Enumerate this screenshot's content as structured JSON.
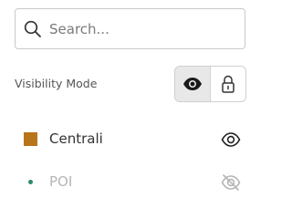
{
  "search": {
    "placeholder": "Search...",
    "value": "",
    "icon": "search-icon"
  },
  "visibility": {
    "label": "Visibility Mode",
    "modes": [
      {
        "icon": "eye-icon",
        "active": true
      },
      {
        "icon": "lock-icon",
        "active": false
      }
    ]
  },
  "layers": [
    {
      "name": "Centrali",
      "swatch": "square",
      "color": "#b8741a",
      "visible": true,
      "icon": "eye-icon"
    },
    {
      "name": "POI",
      "swatch": "dot",
      "color": "#2e8a63",
      "visible": false,
      "icon": "eye-off-icon"
    }
  ],
  "colors": {
    "text": "#333333",
    "muted": "#b5b5b5",
    "border": "#c9c9c9",
    "active_segment": "#e8e8e8"
  }
}
